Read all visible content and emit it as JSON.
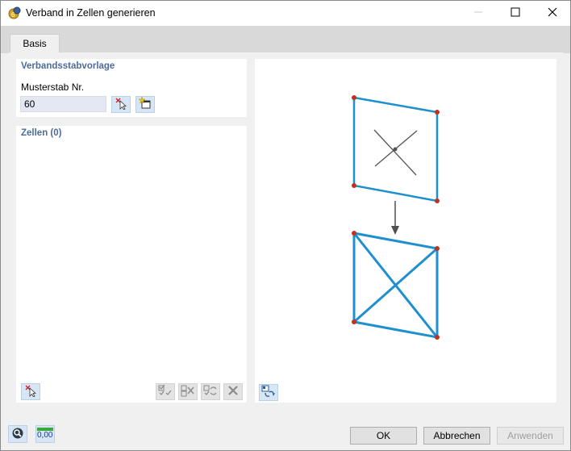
{
  "window": {
    "title": "Verband in Zellen generieren",
    "app_icon": "rfem-app-icon",
    "controls": [
      "minimize-icon",
      "maximize-icon",
      "close-icon"
    ]
  },
  "tabs": [
    {
      "label": "Basis",
      "active": true
    }
  ],
  "template_section": {
    "title": "Verbandsstabvorlage",
    "member_label": "Musterstab Nr.",
    "member_value": "60",
    "buttons": [
      "pick-member-icon",
      "new-member-icon"
    ]
  },
  "cells_section": {
    "title": "Zellen (0)",
    "toolbar_left": [
      "pick-cells-icon"
    ],
    "toolbar_right": [
      "check-all-icon",
      "uncheck-all-icon",
      "invert-selection-icon",
      "delete-icon"
    ]
  },
  "preview": {
    "button": "preview-settings-icon",
    "colors": {
      "line": "#1e8fcf",
      "node": "#c0321e",
      "thin": "#555555",
      "arrow": "#505050"
    }
  },
  "footer": {
    "help_icon": "help-icon",
    "units_icon_text": "0,00",
    "ok_label": "OK",
    "cancel_label": "Abbrechen",
    "apply_label": "Anwenden",
    "apply_enabled": false
  }
}
